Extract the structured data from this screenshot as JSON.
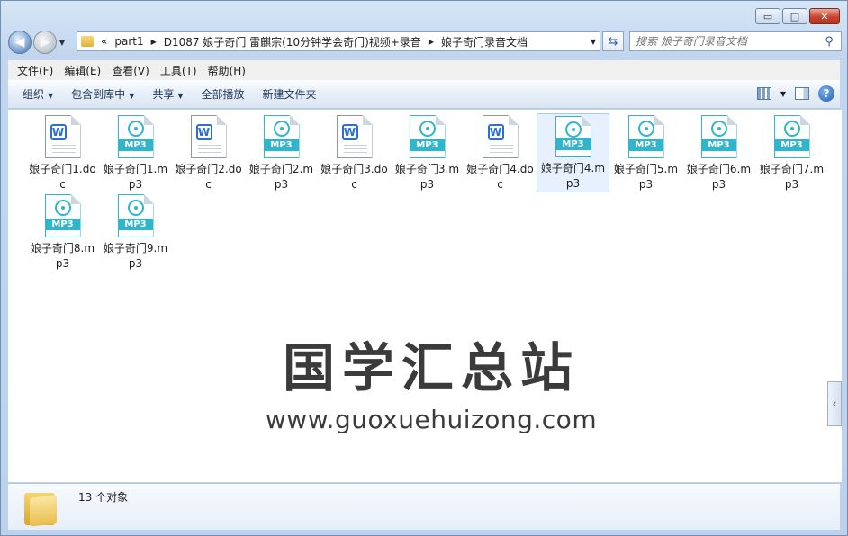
{
  "window": {
    "caption_buttons": {
      "minimize": "▭",
      "maximize": "□",
      "close": "✕"
    }
  },
  "nav": {
    "back_glyph": "◀",
    "forward_glyph": "▶",
    "history_glyph": "▼"
  },
  "address": {
    "overflow": "«",
    "segments": [
      "part1",
      "D1087 娘子奇门 雷麒宗(10分钟学会奇门)视频+录音",
      "娘子奇门录音文档"
    ],
    "separator": "▶",
    "dropdown": "▼",
    "refresh_glyph": "⇆"
  },
  "search": {
    "placeholder": "搜索 娘子奇门录音文档",
    "glyph": "⚲"
  },
  "menu": [
    "文件(F)",
    "编辑(E)",
    "查看(V)",
    "工具(T)",
    "帮助(H)"
  ],
  "toolbar": {
    "organize": "组织",
    "include_library": "包含到库中",
    "share": "共享",
    "play_all": "全部播放",
    "new_folder": "新建文件夹",
    "arrow": "▼",
    "view_arrow": "▼",
    "help": "?"
  },
  "files": [
    {
      "name": "娘子奇门1.doc",
      "type": "doc"
    },
    {
      "name": "娘子奇门1.mp3",
      "type": "mp3"
    },
    {
      "name": "娘子奇门2.doc",
      "type": "doc"
    },
    {
      "name": "娘子奇门2.mp3",
      "type": "mp3"
    },
    {
      "name": "娘子奇门3.doc",
      "type": "doc"
    },
    {
      "name": "娘子奇门3.mp3",
      "type": "mp3"
    },
    {
      "name": "娘子奇门4.doc",
      "type": "doc"
    },
    {
      "name": "娘子奇门4.mp3",
      "type": "mp3",
      "selected": true
    },
    {
      "name": "娘子奇门5.mp3",
      "type": "mp3"
    },
    {
      "name": "娘子奇门6.mp3",
      "type": "mp3"
    },
    {
      "name": "娘子奇门7.mp3",
      "type": "mp3"
    },
    {
      "name": "娘子奇门8.mp3",
      "type": "mp3"
    },
    {
      "name": "娘子奇门9.mp3",
      "type": "mp3"
    }
  ],
  "icon_text": {
    "doc": "W",
    "mp3": "MP3"
  },
  "watermark": {
    "line1": "国学汇总站",
    "line2": "www.guoxuehuizong.com"
  },
  "sidetab_glyph": "‹",
  "status": {
    "count": "13 个对象"
  },
  "colors": {
    "mp3_accent": "#2fb6cc",
    "doc_accent": "#2b6fd4",
    "selection": "#e6f1fd"
  }
}
